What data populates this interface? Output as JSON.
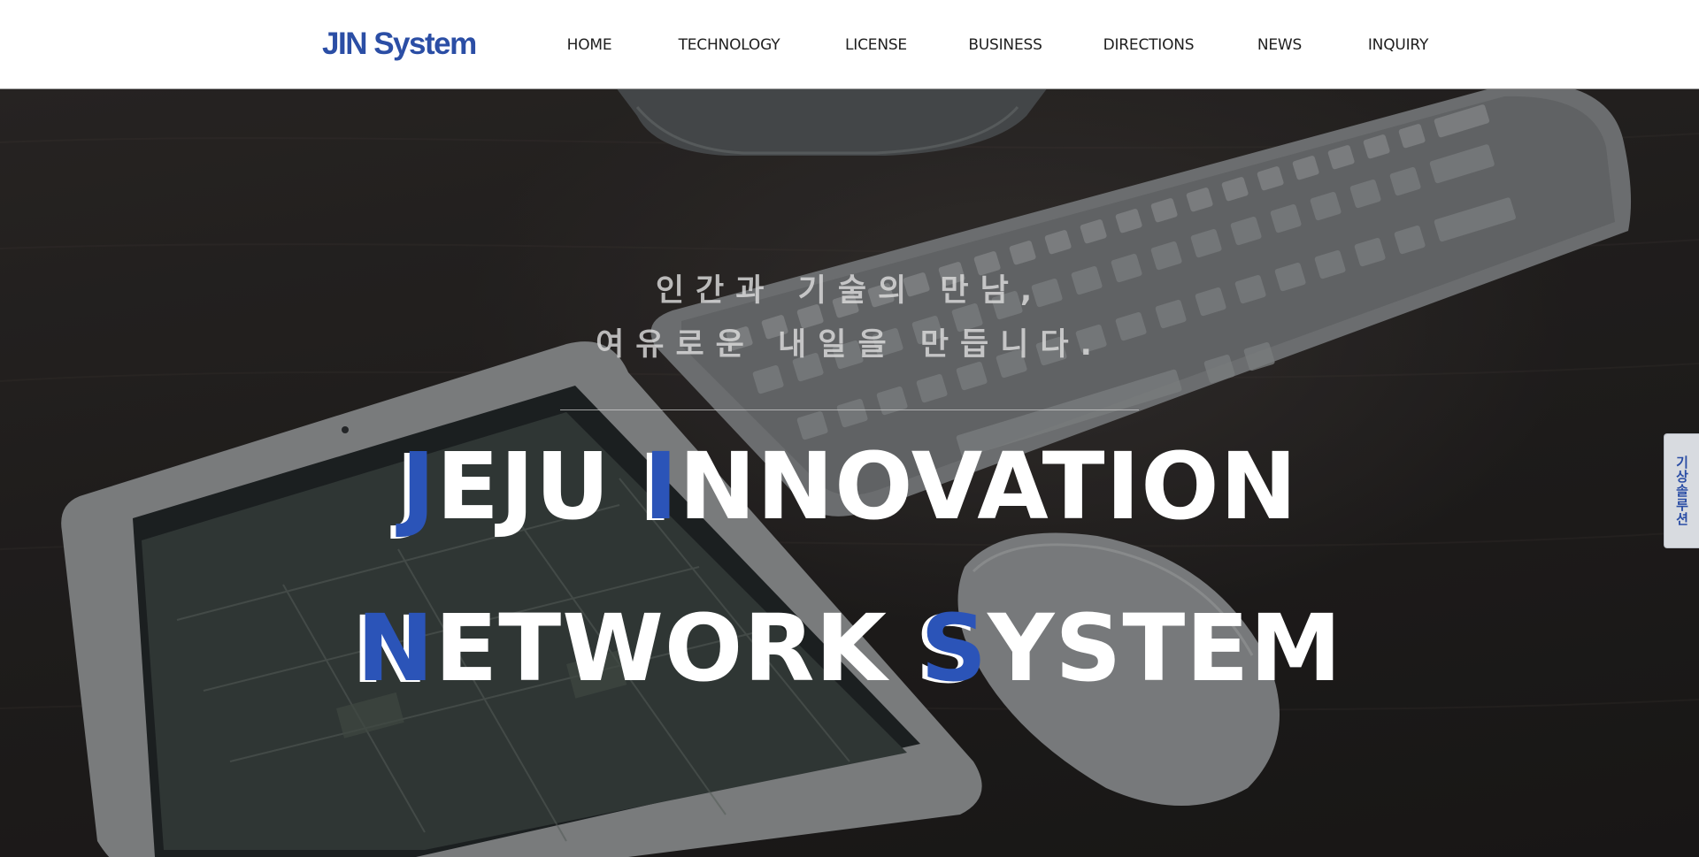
{
  "header": {
    "logo": "JIN System",
    "nav": [
      {
        "label": "HOME"
      },
      {
        "label": "TECHNOLOGY"
      },
      {
        "label": "LICENSE"
      },
      {
        "label": "BUSINESS"
      },
      {
        "label": "DIRECTIONS"
      },
      {
        "label": "NEWS"
      },
      {
        "label": "INQUIRY"
      }
    ]
  },
  "hero": {
    "tagline_line1": "인간과 기술의 만남,",
    "tagline_line2": "여유로운 내일을 만듭니다.",
    "headline_line1": {
      "w1_initial": "J",
      "w1_rest": "EJU ",
      "w2_initial": "I",
      "w2_rest": "NNOVATION"
    },
    "headline_line2": {
      "w1_initial": "N",
      "w1_rest": "ETWORK ",
      "w2_initial": "S",
      "w2_rest": "YSTEM"
    }
  },
  "side_tab": {
    "label": "기상솔루션"
  },
  "colors": {
    "brand": "#2b4ea5",
    "accent": "#2b54b8",
    "header_bg": "#ffffff"
  },
  "icons": [
    "keyboard-image",
    "tablet-image",
    "mouse-image",
    "monitor-base-image"
  ]
}
